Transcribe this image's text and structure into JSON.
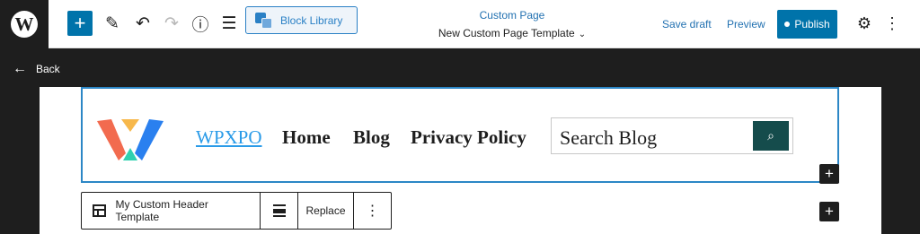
{
  "topbar": {
    "wp_logo": "W",
    "add_icon": "+",
    "pen_icon": "✎",
    "undo_icon": "↶",
    "redo_icon": "↷",
    "info_icon": "ⓘ",
    "list_icon": "☰",
    "block_library_label": "Block Library",
    "document": {
      "post_type": "Custom Page",
      "template_name": "New Custom Page Template",
      "chevron": "⌄"
    },
    "save_draft_label": "Save draft",
    "preview_label": "Preview",
    "publish_label": "Publish",
    "settings_icon": "⚙",
    "options_icon": "⋮"
  },
  "back": {
    "arrow": "←",
    "label": "Back"
  },
  "header_block": {
    "nav": [
      {
        "label": "WPXPO",
        "active": true
      },
      {
        "label": "Home"
      },
      {
        "label": "Blog"
      },
      {
        "label": "Privacy Policy"
      }
    ],
    "search": {
      "placeholder": "Search Blog",
      "button_icon": "⌕"
    },
    "inserter_icon": "+"
  },
  "block_toolbar": {
    "template_label": "My Custom Header Template",
    "replace_label": "Replace",
    "more_icon": "⋮"
  },
  "side_inserter_icon": "+",
  "colors": {
    "accent": "#0073aa",
    "link": "#2271b1",
    "selection_border": "#2c87c6",
    "search_button": "#154c4c",
    "logo_orange": "#f26b4f",
    "logo_blue": "#2a80ef",
    "logo_yellow": "#f7b84b",
    "logo_teal": "#2fd1b0"
  }
}
